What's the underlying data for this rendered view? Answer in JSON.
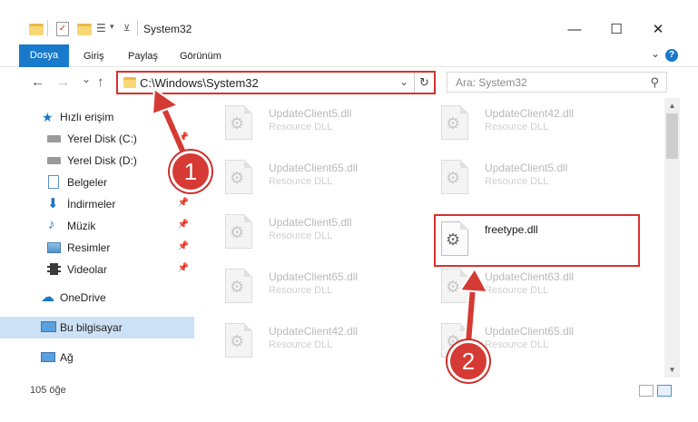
{
  "window": {
    "title": "System32",
    "minimize": "—",
    "maximize": "☐",
    "close": "✕"
  },
  "ribbon": {
    "tabs": [
      "Dosya",
      "Giriş",
      "Paylaş",
      "Görünüm"
    ],
    "help": "?"
  },
  "nav": {
    "back": "←",
    "forward": "→",
    "recent": "⌄",
    "up": "↑",
    "address": "C:\\Windows\\System32",
    "search_placeholder": "Ara: System32"
  },
  "sidebar": {
    "items": [
      {
        "label": "Hızlı erişim",
        "icon": "star-icon",
        "pinned": false
      },
      {
        "label": "Yerel Disk (C:)",
        "icon": "drive-icon",
        "pinned": true
      },
      {
        "label": "Yerel Disk (D:)",
        "icon": "drive-icon",
        "pinned": true
      },
      {
        "label": "Belgeler",
        "icon": "documents-icon",
        "pinned": true
      },
      {
        "label": "İndirmeler",
        "icon": "download-icon",
        "pinned": true
      },
      {
        "label": "Müzik",
        "icon": "music-icon",
        "pinned": true
      },
      {
        "label": "Resimler",
        "icon": "pictures-icon",
        "pinned": true
      },
      {
        "label": "Videolar",
        "icon": "videos-icon",
        "pinned": true
      },
      {
        "label": "OneDrive",
        "icon": "cloud-icon",
        "pinned": false
      },
      {
        "label": "Bu bilgisayar",
        "icon": "computer-icon",
        "pinned": false
      },
      {
        "label": "Ağ",
        "icon": "network-icon",
        "pinned": false
      }
    ]
  },
  "files": [
    {
      "name": "UpdateClient5.dll",
      "type": "Resource DLL"
    },
    {
      "name": "UpdateClient42.dll",
      "type": "Resource DLL"
    },
    {
      "name": "UpdateClient65.dll",
      "type": "Resource DLL"
    },
    {
      "name": "UpdateClient5.dll",
      "type": "Resource DLL"
    },
    {
      "name": "UpdateClient5.dll",
      "type": "Resource DLL"
    },
    {
      "name": "freetype.dll",
      "type": ""
    },
    {
      "name": "UpdateClient65.dll",
      "type": "Resource DLL"
    },
    {
      "name": "UpdateClient63.dll",
      "type": "Resource DLL"
    },
    {
      "name": "UpdateClient42.dll",
      "type": "Resource DLL"
    },
    {
      "name": "UpdateClient65.dll",
      "type": "Resource DLL"
    }
  ],
  "status": {
    "count": "105 öğe"
  },
  "callouts": [
    "1",
    "2"
  ],
  "colors": {
    "accent": "#1979ca",
    "highlight": "#d9312e",
    "selected": "#cce1f5"
  }
}
